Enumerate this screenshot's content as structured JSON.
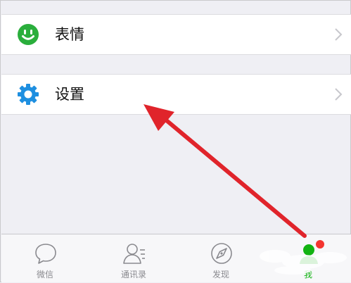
{
  "menu": {
    "items": [
      {
        "label": "表情",
        "icon": "smiley-icon",
        "icon_color": "#2aae3c"
      },
      {
        "label": "设置",
        "icon": "gear-icon",
        "icon_color": "#1e8fe0"
      }
    ]
  },
  "tabbar": {
    "tabs": [
      {
        "label": "微信",
        "icon": "chat-bubble-icon",
        "active": false
      },
      {
        "label": "通讯录",
        "icon": "contacts-icon",
        "active": false
      },
      {
        "label": "发现",
        "icon": "compass-icon",
        "active": false
      },
      {
        "label": "我",
        "icon": "me-icon",
        "active": true,
        "badge": true
      }
    ],
    "active_color": "#12b312",
    "inactive_color": "#8a8a8f",
    "badge_color": "#f43530"
  },
  "annotation": {
    "arrow_color": "#e0242b"
  }
}
